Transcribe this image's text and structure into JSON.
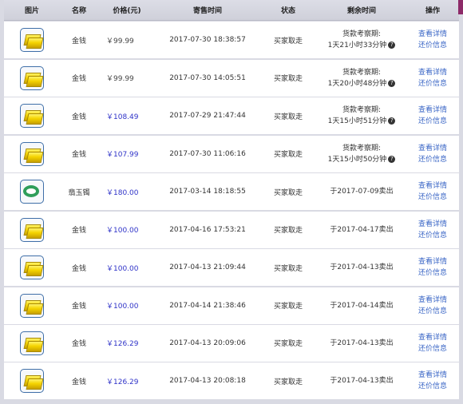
{
  "header": {
    "image": "图片",
    "name": "名称",
    "price": "价格(元)",
    "listed_time": "寄售时间",
    "status": "状态",
    "remaining_time": "剩余时间",
    "actions": "操作"
  },
  "rows": [
    {
      "icon": "gold-ingot-icon",
      "name": "金钱",
      "price": "￥99.99",
      "price_color": "#444444",
      "time": "2017-07-30 18:38:57",
      "status": "买家取走",
      "remain_line1": "货款考察期:",
      "remain_line2": "1天21小时33分钟",
      "help": "?",
      "detail": "查看详情",
      "bargain": "还价信息"
    },
    {
      "icon": "gold-ingot-icon",
      "name": "金钱",
      "price": "￥99.99",
      "price_color": "#444444",
      "time": "2017-07-30 14:05:51",
      "status": "买家取走",
      "remain_line1": "货款考察期:",
      "remain_line2": "1天20小时48分钟",
      "help": "?",
      "detail": "查看详情",
      "bargain": "还价信息"
    },
    {
      "icon": "gold-ingot-icon",
      "name": "金钱",
      "price": "￥108.49",
      "price_color": "#2f33c8",
      "time": "2017-07-29 21:47:44",
      "status": "买家取走",
      "remain_line1": "货款考察期:",
      "remain_line2": "1天15小时51分钟",
      "help": "?",
      "detail": "查看详情",
      "bargain": "还价信息"
    },
    {
      "icon": "gold-ingot-icon",
      "name": "金钱",
      "price": "￥107.99",
      "price_color": "#2f33c8",
      "time": "2017-07-30 11:06:16",
      "status": "买家取走",
      "remain_line1": "货款考察期:",
      "remain_line2": "1天15小时50分钟",
      "help": "?",
      "detail": "查看详情",
      "bargain": "还价信息"
    },
    {
      "icon": "jade-bracelet-icon",
      "name": "翡玉镯",
      "price": "￥180.00",
      "price_color": "#2f33c8",
      "time": "2017-03-14 18:18:55",
      "status": "买家取走",
      "remain_line1": "于2017-07-09卖出",
      "remain_line2": "",
      "help": "",
      "detail": "查看详情",
      "bargain": "还价信息"
    },
    {
      "icon": "gold-ingot-icon",
      "name": "金钱",
      "price": "￥100.00",
      "price_color": "#2f33c8",
      "time": "2017-04-16 17:53:21",
      "status": "买家取走",
      "remain_line1": "于2017-04-17卖出",
      "remain_line2": "",
      "help": "",
      "detail": "查看详情",
      "bargain": "还价信息"
    },
    {
      "icon": "gold-ingot-icon",
      "name": "金钱",
      "price": "￥100.00",
      "price_color": "#2f33c8",
      "time": "2017-04-13 21:09:44",
      "status": "买家取走",
      "remain_line1": "于2017-04-13卖出",
      "remain_line2": "",
      "help": "",
      "detail": "查看详情",
      "bargain": "还价信息"
    },
    {
      "icon": "gold-ingot-icon",
      "name": "金钱",
      "price": "￥100.00",
      "price_color": "#2f33c8",
      "time": "2017-04-14 21:38:46",
      "status": "买家取走",
      "remain_line1": "于2017-04-14卖出",
      "remain_line2": "",
      "help": "",
      "detail": "查看详情",
      "bargain": "还价信息"
    },
    {
      "icon": "gold-ingot-icon",
      "name": "金钱",
      "price": "￥126.29",
      "price_color": "#2f33c8",
      "time": "2017-04-13 20:09:06",
      "status": "买家取走",
      "remain_line1": "于2017-04-13卖出",
      "remain_line2": "",
      "help": "",
      "detail": "查看详情",
      "bargain": "还价信息"
    },
    {
      "icon": "gold-ingot-icon",
      "name": "金钱",
      "price": "￥126.29",
      "price_color": "#2f33c8",
      "time": "2017-04-13 20:08:18",
      "status": "买家取走",
      "remain_line1": "于2017-04-13卖出",
      "remain_line2": "",
      "help": "",
      "detail": "查看详情",
      "bargain": "还价信息"
    }
  ]
}
